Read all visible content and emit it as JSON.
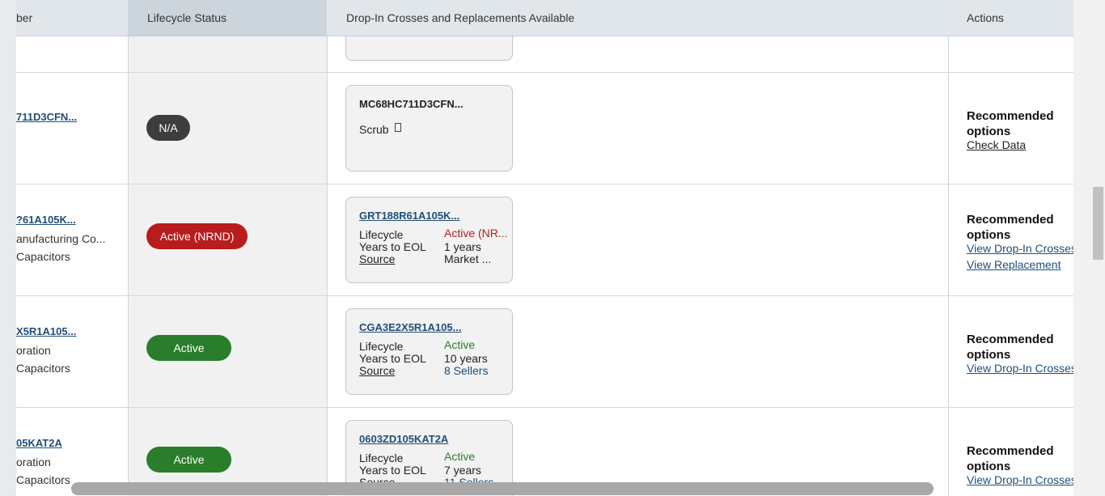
{
  "header": {
    "col_part": "ber",
    "col_lifecycle": "Lifecycle Status",
    "col_crosses": "Drop-In Crosses and Replacements Available",
    "col_actions": "Actions"
  },
  "rows": [
    {
      "part": "711D3CFN...",
      "mfr": "",
      "category": "",
      "status": "N/A",
      "card": {
        "part": "MC68HC711D3CFN...",
        "scrub": "Scrub",
        "scrub_icon": "external-link-icon"
      },
      "rec": "Recommended options",
      "actions": [
        "Check Data"
      ]
    },
    {
      "part": "?61A105K...",
      "mfr": "anufacturing Co...",
      "category": "Capacitors",
      "status": "Active (NRND)",
      "card": {
        "part": "GRT188R61A105K...",
        "lifecycle_label": "Lifecycle",
        "lifecycle_val": "Active (NR...",
        "eol_label": "Years to EOL",
        "eol_val": "1 years",
        "source_label": "Source",
        "source_val": "Market ..."
      },
      "rec": "Recommended options",
      "actions": [
        "View Drop-In Crosses",
        "View Replacement"
      ]
    },
    {
      "part": "X5R1A105...",
      "mfr": "oration",
      "category": "Capacitors",
      "status": "Active",
      "card": {
        "part": "CGA3E2X5R1A105...",
        "lifecycle_label": "Lifecycle",
        "lifecycle_val": "Active",
        "eol_label": "Years to EOL",
        "eol_val": "10 years",
        "source_label": "Source",
        "source_val": "8 Sellers"
      },
      "rec": "Recommended options",
      "actions": [
        "View Drop-In Crosses"
      ]
    },
    {
      "part": "05KAT2A",
      "mfr": "oration",
      "category": "Capacitors",
      "status": "Active",
      "card": {
        "part": "0603ZD105KAT2A",
        "lifecycle_label": "Lifecycle",
        "lifecycle_val": "Active",
        "eol_label": "Years to EOL",
        "eol_val": "7 years",
        "source_label": "Source",
        "source_val": "11 Sellers"
      },
      "rec": "Recommended options",
      "actions": [
        "View Drop-In Crosses"
      ]
    }
  ],
  "colors": {
    "na": "#3d3d3d",
    "nrnd": "#b81c1c",
    "active": "#2a7d2a",
    "link": "#1f4e79"
  }
}
